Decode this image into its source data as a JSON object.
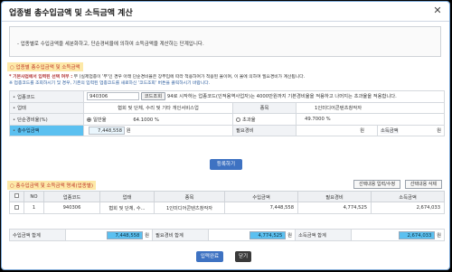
{
  "window": {
    "title": "업종별 총수입금액 및 소득금액 계산",
    "close_glyph": "✕"
  },
  "info": {
    "text": "- 업종별로 수입금액을 세분화하고, 단순경비율에 의하여 소득금액을 계산하는 단계입니다."
  },
  "section1": {
    "title": "○ 업종별 총수입금액 및 소득금액",
    "note1_bold": "* 기본사업에서 입력된 선택 여부 :",
    "note1_rest": " 부 (실제업종이 '부'인 경우 아래 단순경비율은 장부입에 따라 적용하여가 적용된 율이며, 이 율에 의하여 필요경비가 계산됩니다.",
    "note2": "※ 업종코드를 조회하시기 및 경우, 기존의 입력된 업종코드를 새로하신 '코드조회' 버튼을 클릭하시기 바랍니다."
  },
  "form": {
    "code_label": "업종코드",
    "code_value": "940306",
    "code_btn": "코드조회",
    "code_hint": "94로 시작하는 업종코드(인적용역사업자)는 4000만원까지 기본경비율을 적용하고 나머지는 초과율을 적용합니다.",
    "type_label": "업태",
    "type_value": "협회 및 단체, 수리 및 기타 개인서비스업",
    "item_label": "종목",
    "item_value": "1인미디어콘텐츠창작자",
    "rate_label": "단순경비율(%)",
    "rate_opt1": "일반율",
    "rate_val1": "64.1000 %",
    "rate_opt2": "초과율",
    "rate_val2": "49.7000 %",
    "income_label": "총수입금액",
    "income_value": "7,448,558",
    "income_unit": "원",
    "expense_label": "필요경비",
    "expense_unit": "원",
    "profit_label": "소득금액",
    "profit_unit": "원"
  },
  "register_btn": "등록하기",
  "section2": {
    "title": "○ 총수입금액 및 소득금액 명세(업종별)",
    "btn_edit": "선택내용 입력/수정",
    "btn_delete": "선택내용 삭제"
  },
  "grid": {
    "headers": [
      "",
      "NO",
      "업종코드",
      "업태",
      "종목",
      "수입금액",
      "필요경비",
      "소득금액"
    ],
    "rows": [
      {
        "no": "1",
        "code": "940306",
        "type": "협회 및 단체, 수...",
        "item": "1인미디어콘텐츠창작자",
        "income": "7,448,558",
        "expense": "4,774,525",
        "profit": "2,674,033"
      }
    ]
  },
  "totals": {
    "income_label": "수입금액 합계",
    "income_value": "7,448,558",
    "income_unit": "원",
    "expense_label": "필요경비 합계",
    "expense_value": "4,774,525",
    "expense_unit": "원",
    "profit_label": "소득금액 합계",
    "profit_value": "2,674,033",
    "profit_unit": "원"
  },
  "footer": {
    "done_btn": "입력완료",
    "close_btn": "닫기"
  },
  "colors": {
    "accent": "#3e72c2",
    "highlight": "#5bc0f0",
    "section_bg": "#fde9a8",
    "section_fg": "#c0392b"
  }
}
